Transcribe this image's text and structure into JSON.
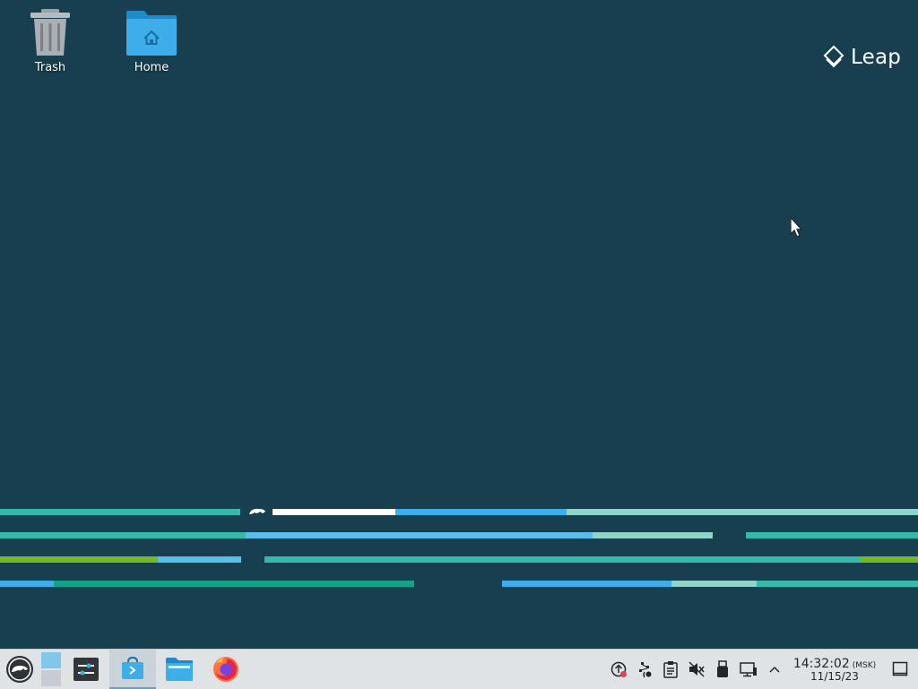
{
  "desktop": {
    "background": "#173f4f",
    "icons": [
      {
        "label": "Trash",
        "icon": "trash-icon"
      },
      {
        "label": "Home",
        "icon": "home-folder-icon"
      }
    ],
    "wallpaper_logo": {
      "text": "Leap",
      "icon": "leap-diamond-icon"
    }
  },
  "taskbar": {
    "app_launcher": {
      "icon": "opensuse-launcher-icon"
    },
    "pager": {
      "icon": "virtual-desktop-pager-icon"
    },
    "tasks": [
      {
        "icon": "settings-icon"
      },
      {
        "icon": "discover-store-icon",
        "active": true
      },
      {
        "icon": "file-manager-icon"
      },
      {
        "icon": "firefox-icon"
      }
    ],
    "tray": [
      {
        "icon": "update-notifier-icon"
      },
      {
        "icon": "network-icon"
      },
      {
        "icon": "clipboard-icon"
      },
      {
        "icon": "volume-muted-icon"
      },
      {
        "icon": "usb-device-icon"
      },
      {
        "icon": "display-icon"
      },
      {
        "icon": "chevron-up-icon"
      }
    ],
    "clock": {
      "time": "14:32:02",
      "timezone": "(MSK)",
      "date": "11/15/23"
    },
    "show_desktop": {
      "icon": "show-desktop-icon"
    }
  },
  "colors": {
    "accent": "#3daee9",
    "teal": "#35b9ab",
    "green": "#73ba25",
    "light_teal": "#8fd3c9",
    "dark_teal": "#11a28c"
  }
}
